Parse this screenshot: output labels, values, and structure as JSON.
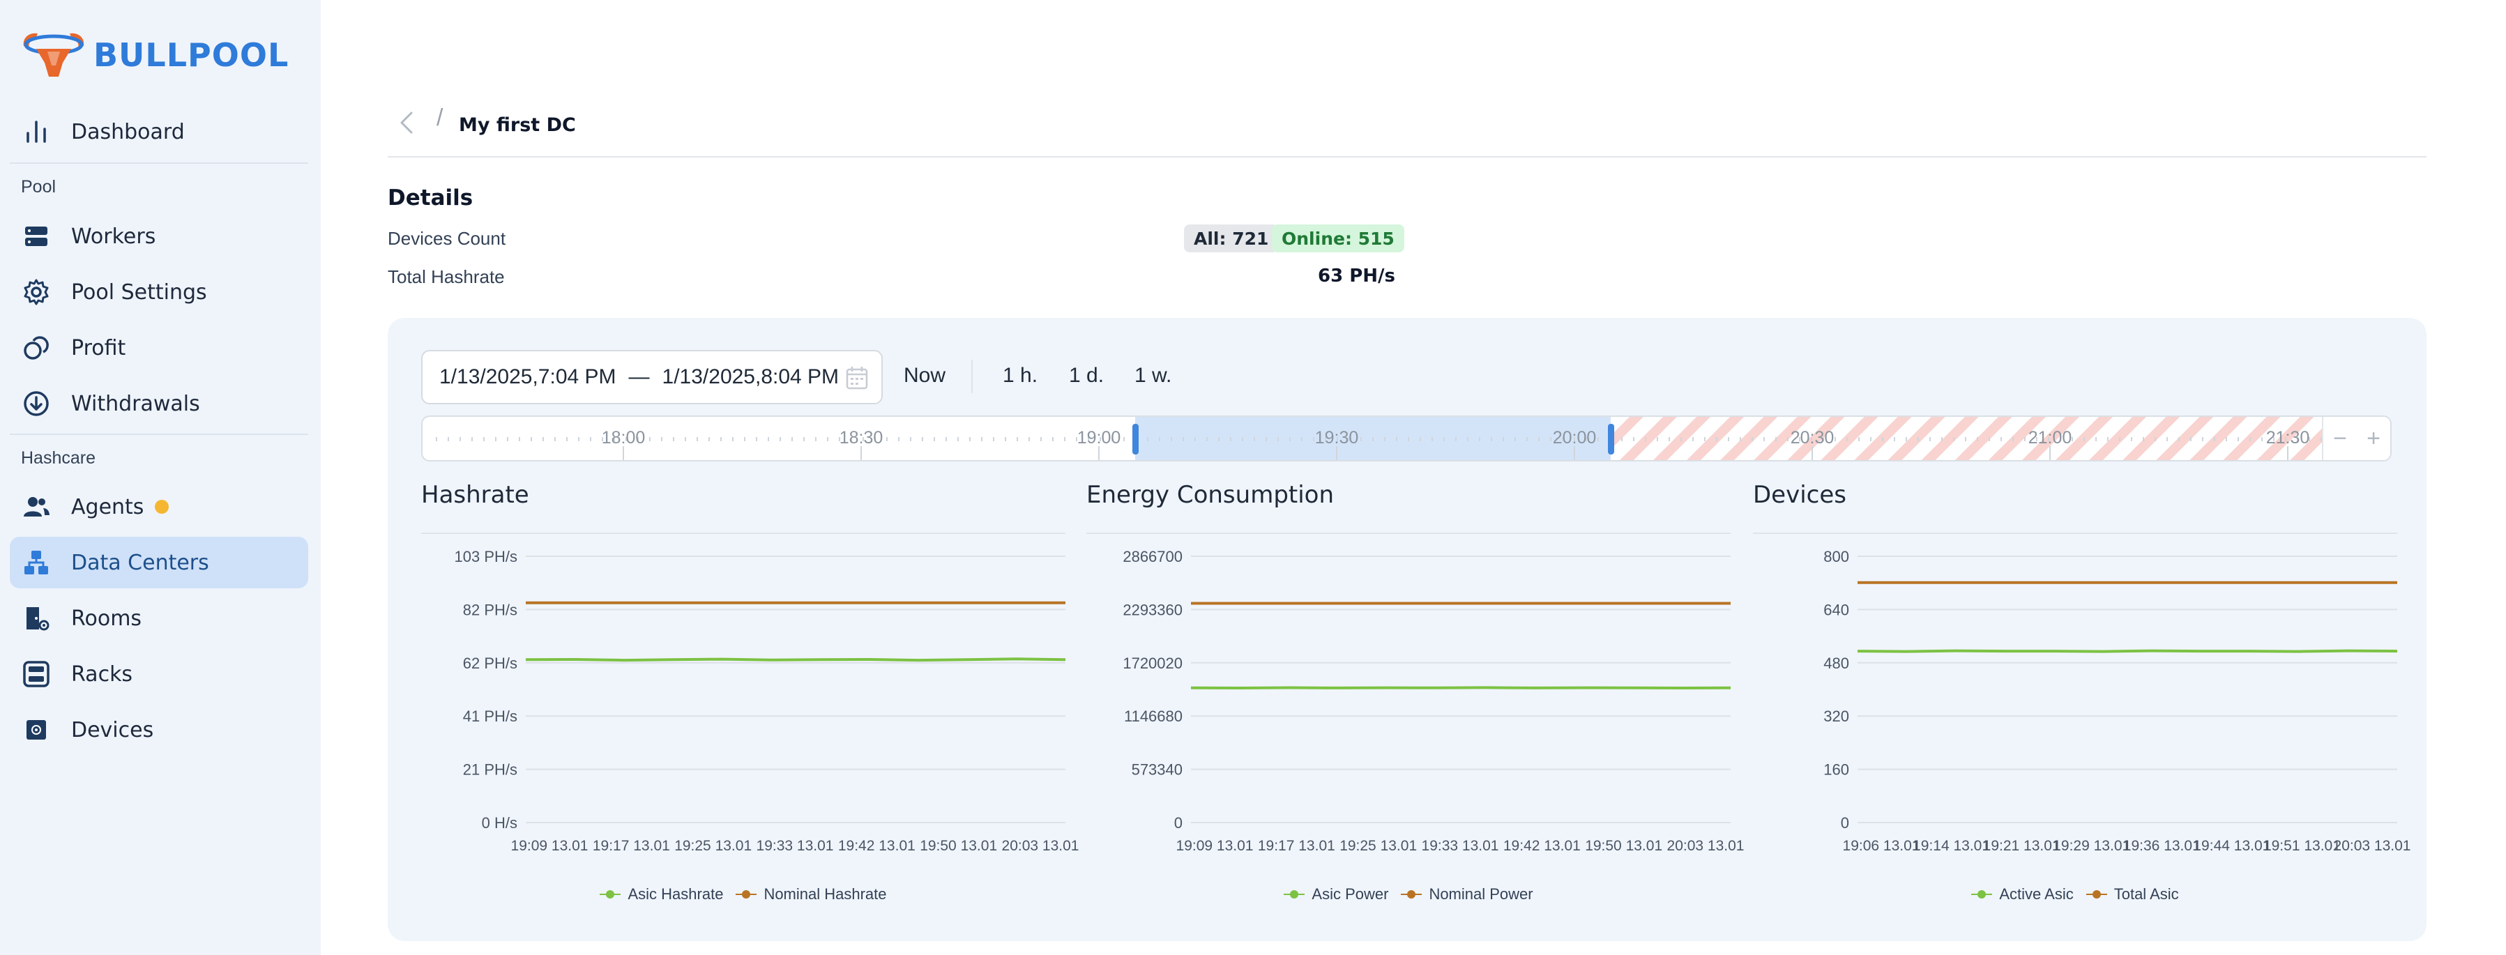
{
  "brand": {
    "name": "BULLPOOL"
  },
  "colors": {
    "accent": "#2f7bd9",
    "sidebar_bg": "#eff4fb",
    "active_bg": "#cfe1f8",
    "green": "#7cc243",
    "orange": "#b87424",
    "agent_badge": "#f5b731"
  },
  "sidebar": {
    "dashboard": {
      "label": "Dashboard",
      "icon": "bar-chart-icon"
    },
    "pool_section": "Pool",
    "pool_items": [
      {
        "label": "Workers",
        "icon": "server-icon"
      },
      {
        "label": "Pool Settings",
        "icon": "gear-icon"
      },
      {
        "label": "Profit",
        "icon": "coins-icon"
      },
      {
        "label": "Withdrawals",
        "icon": "arrow-down-circle-icon"
      }
    ],
    "hashcare_section": "Hashcare",
    "hashcare_items": [
      {
        "label": "Agents",
        "icon": "users-icon",
        "badge": true
      },
      {
        "label": "Data Centers",
        "icon": "network-icon",
        "active": true
      },
      {
        "label": "Rooms",
        "icon": "room-icon"
      },
      {
        "label": "Racks",
        "icon": "rack-icon"
      },
      {
        "label": "Devices",
        "icon": "chip-icon"
      }
    ]
  },
  "breadcrumb": {
    "separator": "/",
    "current": "My first DC"
  },
  "details": {
    "title": "Details",
    "devices_count_label": "Devices Count",
    "all_badge": "All: 721",
    "online_badge": "Online: 515",
    "total_hashrate_label": "Total Hashrate",
    "total_hashrate_value": "63 PH/s"
  },
  "date_range": {
    "start": "1/13/2025,7:04 PM",
    "separator": "—",
    "end": "1/13/2025,8:04 PM",
    "now_label": "Now",
    "ranges": [
      "1 h.",
      "1 d.",
      "1 w."
    ]
  },
  "timeline": {
    "tick_labels": [
      "18:00",
      "18:30",
      "19:00",
      "19:30",
      "20:00",
      "20:30",
      "21:00",
      "21:30"
    ],
    "selection_start": "19:04",
    "selection_end": "20:04",
    "zoom_out": "−",
    "zoom_in": "+"
  },
  "chart_data": [
    {
      "type": "line",
      "title": "Hashrate",
      "y_ticks": [
        "0 H/s",
        "21 PH/s",
        "41 PH/s",
        "62 PH/s",
        "82 PH/s",
        "103 PH/s"
      ],
      "ylim": [
        0,
        103
      ],
      "x_labels": [
        "19:09 13.01",
        "19:17 13.01",
        "19:25 13.01",
        "19:33 13.01",
        "19:42 13.01",
        "19:50 13.01",
        "20:03 13.01"
      ],
      "series": [
        {
          "name": "Asic Hashrate",
          "color": "#7cc243",
          "values": [
            63,
            63.1,
            62.8,
            63,
            63.2,
            62.9,
            63,
            63.1,
            62.8,
            63,
            63.3,
            63
          ]
        },
        {
          "name": "Nominal Hashrate",
          "color": "#b87424",
          "values": [
            85,
            85,
            85,
            85,
            85,
            85,
            85,
            85,
            85,
            85,
            85,
            85
          ]
        }
      ]
    },
    {
      "type": "line",
      "title": "Energy Consumption",
      "y_ticks": [
        "0",
        "573340",
        "1146680",
        "1720020",
        "2293360",
        "2866700"
      ],
      "ylim": [
        0,
        2866700
      ],
      "x_labels": [
        "19:09 13.01",
        "19:17 13.01",
        "19:25 13.01",
        "19:33 13.01",
        "19:42 13.01",
        "19:50 13.01",
        "20:03 13.01"
      ],
      "series": [
        {
          "name": "Asic Power",
          "color": "#7cc243",
          "values": [
            1450000,
            1448000,
            1452000,
            1449000,
            1451000,
            1450000,
            1453000,
            1449000,
            1451000,
            1450000,
            1448000,
            1450000
          ]
        },
        {
          "name": "Nominal Power",
          "color": "#b87424",
          "values": [
            2360000,
            2360000,
            2360000,
            2360000,
            2360000,
            2360000,
            2360000,
            2360000,
            2360000,
            2360000,
            2360000,
            2360000
          ]
        }
      ]
    },
    {
      "type": "line",
      "title": "Devices",
      "y_ticks": [
        "0",
        "160",
        "320",
        "480",
        "640",
        "800"
      ],
      "ylim": [
        0,
        800
      ],
      "x_labels": [
        "19:06 13.01",
        "19:14 13.01",
        "19:21 13.01",
        "19:29 13.01",
        "19:36 13.01",
        "19:44 13.01",
        "19:51 13.01",
        "20:03 13.01"
      ],
      "series": [
        {
          "name": "Active Asic",
          "color": "#7cc243",
          "values": [
            515,
            514,
            516,
            515,
            515,
            514,
            516,
            515,
            515,
            514,
            516,
            515
          ]
        },
        {
          "name": "Total Asic",
          "color": "#b87424",
          "values": [
            721,
            721,
            721,
            721,
            721,
            721,
            721,
            721,
            721,
            721,
            721,
            721
          ]
        }
      ]
    }
  ]
}
